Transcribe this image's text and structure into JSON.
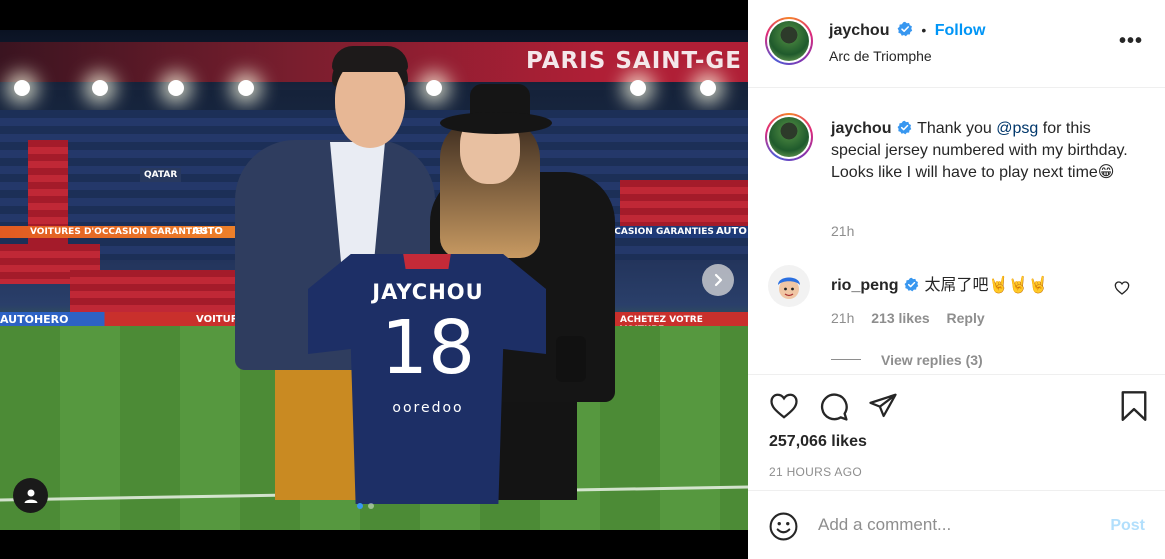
{
  "photo": {
    "banner_text": "PARIS SAINT-GE",
    "ad_left": "VOITURES D'OCCASION GARANTIES",
    "ad_left2": "AUTO",
    "ad_right": "OCCASION GARANTIES",
    "ad_right2": "AUTO",
    "ad_bottom_left": "AUTOHERO",
    "ad_bottom_mid": "VOITURES",
    "ad_bottom_right": "ACHETEZ VOTRE VOITURE",
    "stand_sign": "QATAR",
    "jersey_name": "JAYCHOU",
    "jersey_number": "18",
    "jersey_sponsor": "ooredoo",
    "carousel_dots": 2,
    "carousel_active": 1
  },
  "post": {
    "author": "jaychou",
    "follow_label": "Follow",
    "separator": "•",
    "location": "Arc de Triomphe",
    "more_label": "•••",
    "caption": {
      "user": "jaychou",
      "text_before": "Thank you",
      "mention": "@psg",
      "text_after": "for this special jersey numbered with my birthday. Looks like I will have to play next time😁",
      "time": "21h"
    },
    "comments": [
      {
        "user": "rio_peng",
        "text": "太屌了吧🤘🤘🤘",
        "time": "21h",
        "likes": "213 likes",
        "reply_label": "Reply",
        "view_replies": "View replies (3)"
      }
    ],
    "likes": "257,066 likes",
    "time_ago": "21 HOURS AGO",
    "comment_placeholder": "Add a comment...",
    "post_label": "Post"
  },
  "colors": {
    "accent": "#0095f6",
    "verified": "#3897f0",
    "post_disabled": "#b2dffc",
    "muted": "#8e8e8e"
  },
  "icons": [
    "heart-icon",
    "comment-icon",
    "share-icon",
    "bookmark-icon",
    "emoji-icon",
    "chevron-right-icon",
    "user-tag-icon",
    "verified-badge-icon",
    "more-options-icon",
    "like-comment-heart-icon"
  ]
}
